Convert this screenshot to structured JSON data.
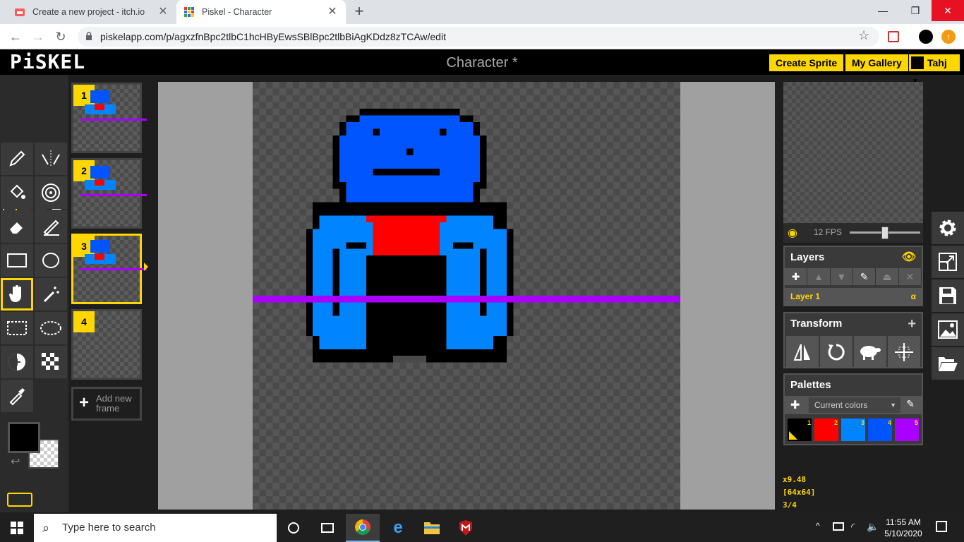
{
  "browser": {
    "tabs": [
      {
        "title": "Create a new project - itch.io"
      },
      {
        "title": "Piskel - Character"
      }
    ],
    "url": "piskelapp.com/p/agxzfnBpc2tlbC1hcHByEwsSBlBpc2tlbBiAgKDdz8zTCAw/edit"
  },
  "app": {
    "logo": "PiSKEL",
    "title": "Character *",
    "create_sprite": "Create Sprite",
    "my_gallery": "My Gallery",
    "user": "Tahj"
  },
  "frames": {
    "items": [
      {
        "num": "1"
      },
      {
        "num": "2"
      },
      {
        "num": "3"
      },
      {
        "num": "4"
      }
    ],
    "selected": 3,
    "add_line1": "Add new",
    "add_line2": "frame"
  },
  "preview": {
    "fps": "12 FPS",
    "fps_slider_value": 12
  },
  "layers": {
    "title": "Layers",
    "layer_name": "Layer 1",
    "alpha": "α"
  },
  "transform": {
    "title": "Transform"
  },
  "palettes": {
    "title": "Palettes",
    "selected": "Current colors",
    "colors": [
      {
        "num": "1",
        "hex": "#000000"
      },
      {
        "num": "2",
        "hex": "#ff0000"
      },
      {
        "num": "3",
        "hex": "#0084ff"
      },
      {
        "num": "4",
        "hex": "#0055ff"
      },
      {
        "num": "5",
        "hex": "#aa00ff"
      }
    ]
  },
  "status": {
    "zoom": "x9.48",
    "size": "[64x64]",
    "frame": "3/4"
  },
  "colors": {
    "primary": "#000000",
    "accent": "#ffd700",
    "guide_line": "#aa00ff"
  },
  "taskbar": {
    "search": "Type here to search",
    "time": "11:55 AM",
    "date": "5/10/2020"
  }
}
